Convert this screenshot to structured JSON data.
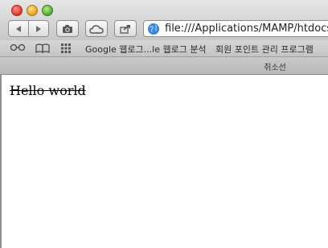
{
  "toolbar": {
    "address_url": "file:///Applications/MAMP/htdocs/"
  },
  "bookmarks": {
    "items": [
      {
        "label": "Google 웹로그...le 웹로그 분석"
      },
      {
        "label": "회원 포인트 관리 프로그램"
      }
    ]
  },
  "tab": {
    "title": "취소선"
  },
  "page": {
    "text": "Hello world"
  },
  "icons": [
    "back-arrow-icon",
    "forward-arrow-icon",
    "camera-icon",
    "cloud-icon",
    "share-icon",
    "globe-icon",
    "reading-glasses-icon",
    "book-icon",
    "grid-icon"
  ],
  "colors": {
    "close": "#d8362b",
    "minimize": "#e0a21f",
    "zoom": "#4fa62b"
  }
}
